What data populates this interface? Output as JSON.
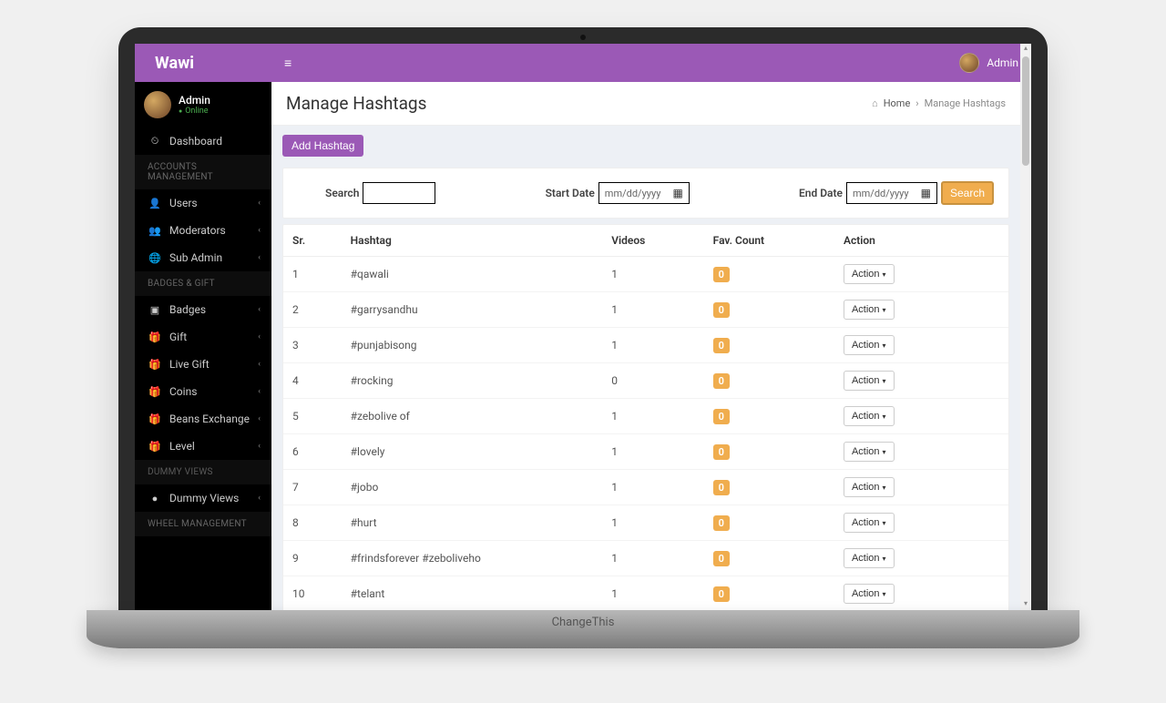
{
  "device_label": "ChangeThis",
  "brand": "Wawi",
  "topbar_user": "Admin",
  "sidebar": {
    "profile_name": "Admin",
    "profile_status": "Online",
    "groups": [
      {
        "type": "item",
        "icon": "⏲",
        "label": "Dashboard",
        "expandable": false
      },
      {
        "type": "header",
        "label": "ACCOUNTS MANAGEMENT"
      },
      {
        "type": "item",
        "icon": "👤",
        "label": "Users",
        "expandable": true
      },
      {
        "type": "item",
        "icon": "👥",
        "label": "Moderators",
        "expandable": true
      },
      {
        "type": "item",
        "icon": "🌐",
        "label": "Sub Admin",
        "expandable": true
      },
      {
        "type": "header",
        "label": "BADGES & GIFT"
      },
      {
        "type": "item",
        "icon": "▣",
        "label": "Badges",
        "expandable": true
      },
      {
        "type": "item",
        "icon": "🎁",
        "label": "Gift",
        "expandable": true
      },
      {
        "type": "item",
        "icon": "🎁",
        "label": "Live Gift",
        "expandable": true
      },
      {
        "type": "item",
        "icon": "🎁",
        "label": "Coins",
        "expandable": true
      },
      {
        "type": "item",
        "icon": "🎁",
        "label": "Beans Exchange",
        "expandable": true
      },
      {
        "type": "item",
        "icon": "🎁",
        "label": "Level",
        "expandable": true
      },
      {
        "type": "header",
        "label": "Dummy Views",
        "small": true
      },
      {
        "type": "item",
        "icon": "●",
        "label": "Dummy Views",
        "expandable": true
      },
      {
        "type": "header",
        "label": "WHEEL MANAGEMENT"
      }
    ]
  },
  "page": {
    "title": "Manage Hashtags",
    "breadcrumb_home": "Home",
    "breadcrumb_current": "Manage Hashtags",
    "add_button": "Add Hashtag",
    "filters": {
      "search_label": "Search",
      "start_label": "Start Date",
      "end_label": "End Date",
      "date_placeholder": "mm/dd/yyyy",
      "search_button": "Search"
    },
    "columns": [
      "Sr.",
      "Hashtag",
      "Videos",
      "Fav. Count",
      "Action"
    ],
    "action_label": "Action",
    "rows": [
      {
        "sr": "1",
        "hashtag": "#qawali",
        "videos": "1",
        "fav": "0"
      },
      {
        "sr": "2",
        "hashtag": "#garrysandhu",
        "videos": "1",
        "fav": "0"
      },
      {
        "sr": "3",
        "hashtag": "#punjabisong",
        "videos": "1",
        "fav": "0"
      },
      {
        "sr": "4",
        "hashtag": "#rocking",
        "videos": "0",
        "fav": "0"
      },
      {
        "sr": "5",
        "hashtag": "#zebolive of",
        "videos": "1",
        "fav": "0"
      },
      {
        "sr": "6",
        "hashtag": "#lovely",
        "videos": "1",
        "fav": "0"
      },
      {
        "sr": "7",
        "hashtag": "#jobo",
        "videos": "1",
        "fav": "0"
      },
      {
        "sr": "8",
        "hashtag": "#hurt",
        "videos": "1",
        "fav": "0"
      },
      {
        "sr": "9",
        "hashtag": "#frindsforever #zeboliveho",
        "videos": "1",
        "fav": "0"
      },
      {
        "sr": "10",
        "hashtag": "#telant",
        "videos": "1",
        "fav": "0"
      }
    ]
  }
}
